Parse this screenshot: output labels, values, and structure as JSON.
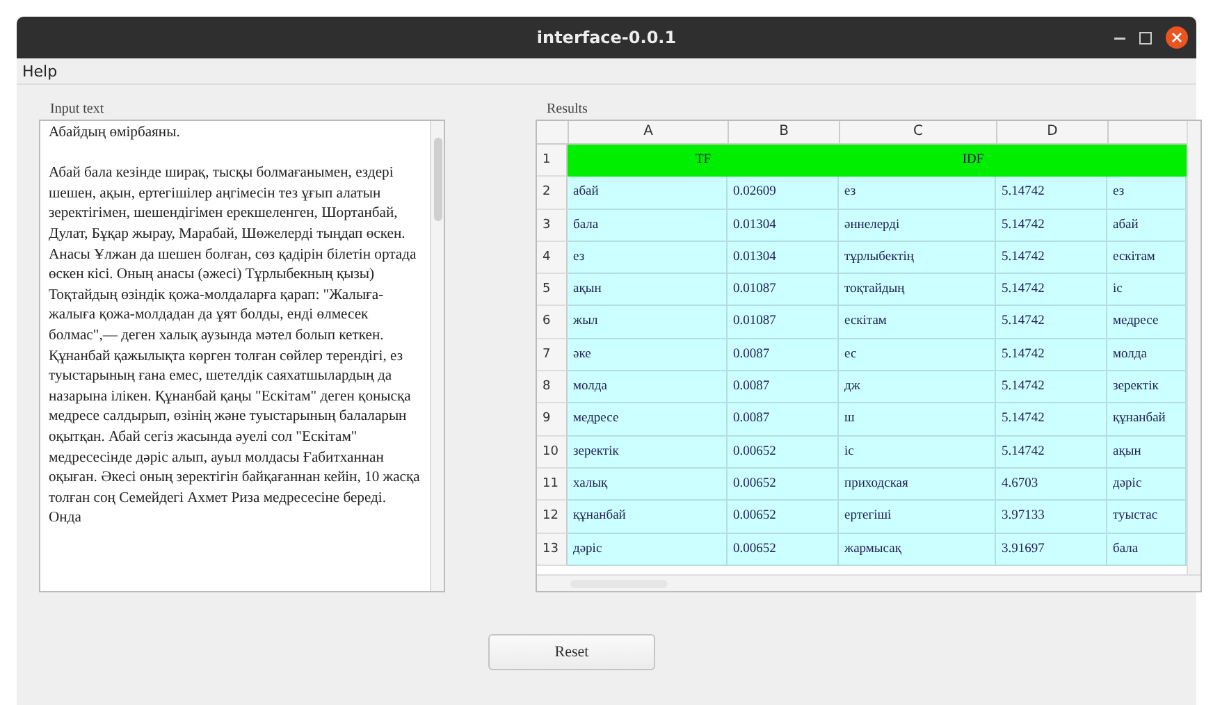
{
  "window": {
    "title": "interface-0.0.1"
  },
  "menu": [
    "Help"
  ],
  "input": {
    "label": "Input text",
    "text": "Абайдың өмірбаяны.\n\nАбай бала кезінде ширақ, тысқы болмағанымен, ездері шешен, ақын, ертегішілер аңгімесін тез ұғып алатын зеректігімен, шешендігімен ерекшеленген, Шортанбай, Дулат, Бұқар жырау, Марабай, Шөжелерді тыңдап өскен. Анасы Ұлжан да шешен болған, сөз қадірін білетін ортада өскен кісі. Оның анасы (әжесі) Тұрлыбекның қызы) Тоқтайдың өзіндік қожа-молдаларға қарап: \"Жалыға-жалыға қожа-молдадан да ұят болды, енді өлмесек болмас\",— деген халық аузында мәтел болып кеткен. Құнанбай қажылықта көрген толған сөйлер терендігі, ез туыстарының ғана емес, шетелдік саяхатшылардың да назарына ілікен. Құнанбай қаңы \"Ескітам\" деген қонысқа медресе салдырып, өзінің және туыстарының балаларын оқытқан. Абай сегіз жасында әуелі сол \"Ескітам\" медресесінде дәріс алып, ауыл молдасы Ғабитханнан оқыған. Әкесі оның зеректігін байқағаннан кейін, 10 жасқа толған соң Семейдегі Ахмет Риза медресесіне береді. Онда"
  },
  "results": {
    "label": "Results",
    "columns": [
      "A",
      "B",
      "C",
      "D"
    ],
    "header_cells": [
      "TF",
      "IDF"
    ],
    "rows": [
      {
        "number": "1"
      },
      {
        "number": "2",
        "cells": [
          "абай",
          "0.02609",
          "ез",
          "5.14742",
          "ез"
        ]
      },
      {
        "number": "3",
        "cells": [
          "бала",
          "0.01304",
          "әннелерді",
          "5.14742",
          "абай"
        ]
      },
      {
        "number": "4",
        "cells": [
          "ез",
          "0.01304",
          "тұрлыбектің",
          "5.14742",
          "ескітам"
        ]
      },
      {
        "number": "5",
        "cells": [
          "ақын",
          "0.01087",
          "тоқтайдың",
          "5.14742",
          "іс"
        ]
      },
      {
        "number": "6",
        "cells": [
          "жыл",
          "0.01087",
          "ескітам",
          "5.14742",
          "медресе"
        ]
      },
      {
        "number": "7",
        "cells": [
          "әке",
          "0.0087",
          "ес",
          "5.14742",
          "молда"
        ]
      },
      {
        "number": "8",
        "cells": [
          "молда",
          "0.0087",
          "дж",
          "5.14742",
          "зеректік"
        ]
      },
      {
        "number": "9",
        "cells": [
          "медресе",
          "0.0087",
          "ш",
          "5.14742",
          "құнанбай"
        ]
      },
      {
        "number": "10",
        "cells": [
          "зеректік",
          "0.00652",
          "іс",
          "5.14742",
          "ақын"
        ]
      },
      {
        "number": "11",
        "cells": [
          "халық",
          "0.00652",
          "приходская",
          "4.6703",
          "дәріс"
        ]
      },
      {
        "number": "12",
        "cells": [
          "құнанбай",
          "0.00652",
          "ертегіші",
          "3.97133",
          "туыстас"
        ]
      },
      {
        "number": "13",
        "cells": [
          "дәріс",
          "0.00652",
          "жармысақ",
          "3.91697",
          "бала"
        ]
      }
    ]
  },
  "buttons": [
    "Reset"
  ]
}
